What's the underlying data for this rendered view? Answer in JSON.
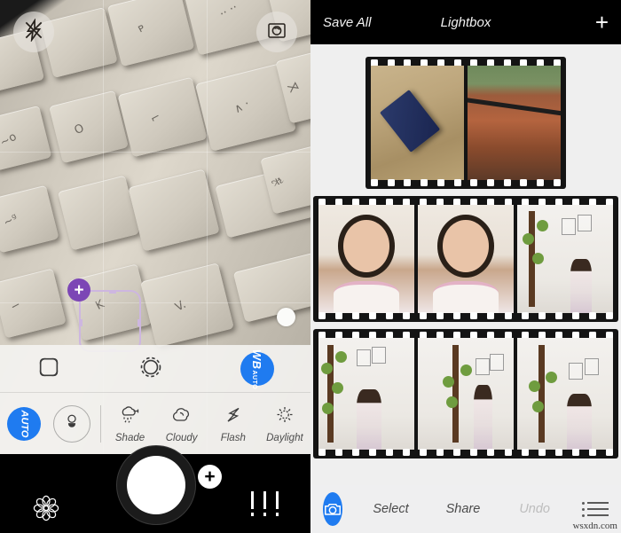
{
  "camera": {
    "flash_icon": "flash-off-icon",
    "flip_icon": "camera-flip-icon",
    "focus_handle_label": "+",
    "exposure_row": {
      "focus_icon": "focus-square-icon",
      "exposure_icon": "exposure-circle-icon",
      "wb_button": {
        "main": "WB",
        "sub": "AUTO"
      }
    },
    "wb_row": {
      "auto_label": "AUTO",
      "tint_icon": "tint-adjust-icon",
      "presets": [
        {
          "label": "Shade",
          "icon": "shade-icon"
        },
        {
          "label": "Cloudy",
          "icon": "cloud-icon"
        },
        {
          "label": "Flash",
          "icon": "flash-bolt-icon"
        },
        {
          "label": "Daylight",
          "icon": "sun-icon"
        }
      ]
    },
    "shutter_bar": {
      "settings_icon": "flower-settings-icon",
      "shutter_label": "shutter-button",
      "add_badge": "+",
      "sliders_icon": "sliders-icon"
    }
  },
  "lightbox": {
    "topbar": {
      "save_all": "Save All",
      "title": "Lightbox",
      "add": "+"
    },
    "strips": [
      {
        "name": "filmstrip-1",
        "frames": [
          {
            "alt": "blue SD card on wooden table",
            "style": "ph-sd"
          },
          {
            "alt": "terracotta roof tiles with palm trees",
            "style": "ph-roof"
          }
        ]
      },
      {
        "name": "filmstrip-2",
        "frames": [
          {
            "alt": "girl selfie pursed lips",
            "style": "ph-self"
          },
          {
            "alt": "girl selfie peace sign",
            "style": "ph-self"
          },
          {
            "alt": "girl standing by tree wall decal",
            "style": "ph-wall"
          }
        ]
      },
      {
        "name": "filmstrip-3",
        "frames": [
          {
            "alt": "girl side view by tree decal",
            "style": "ph-wall"
          },
          {
            "alt": "girl profile standing by tree decal",
            "style": "ph-wall"
          },
          {
            "alt": "girl touching tree wall decal",
            "style": "ph-wall"
          }
        ]
      }
    ],
    "bottombar": {
      "camera_icon": "camera-icon",
      "select": "Select",
      "share": "Share",
      "undo": "Undo",
      "undo_disabled": true,
      "list_icon": "list-menu-icon"
    }
  },
  "watermark": "wsxdn.com",
  "colors": {
    "accent_blue": "#1f7bf0",
    "focus_purple": "#7c46b5",
    "focus_box": "#cdb6e0",
    "panel_bg": "#efefef",
    "bar_black": "#000000",
    "disabled_text": "#bdbdbd"
  }
}
